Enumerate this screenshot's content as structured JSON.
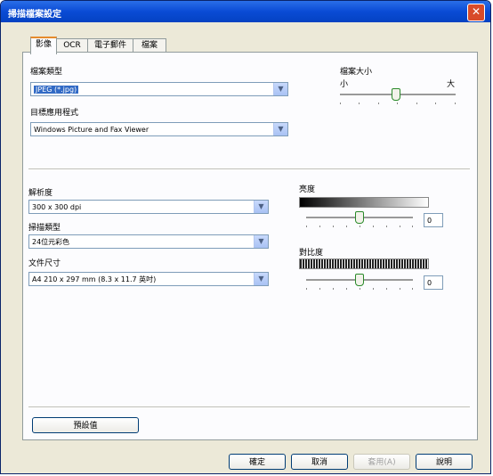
{
  "window": {
    "title": "掃描檔案設定"
  },
  "tabs": [
    "影像",
    "OCR",
    "電子郵件",
    "檔案"
  ],
  "file_type": {
    "label": "檔案類型",
    "value": "JPEG (*.jpg)"
  },
  "target_app": {
    "label": "目標應用程式",
    "value": "Windows Picture and Fax Viewer"
  },
  "file_size": {
    "label": "檔案大小",
    "small": "小",
    "large": "大"
  },
  "resolution": {
    "label": "解析度",
    "value": "300 x 300 dpi"
  },
  "scan_type": {
    "label": "掃描類型",
    "value": "24位元彩色"
  },
  "document_size": {
    "label": "文件尺寸",
    "value": "A4 210 x 297 mm (8.3 x 11.7 英吋)"
  },
  "brightness": {
    "label": "亮度",
    "value": "0"
  },
  "contrast": {
    "label": "對比度",
    "value": "0"
  },
  "buttons": {
    "default": "預設值",
    "ok": "確定",
    "cancel": "取消",
    "apply": "套用(A)",
    "help": "說明"
  }
}
